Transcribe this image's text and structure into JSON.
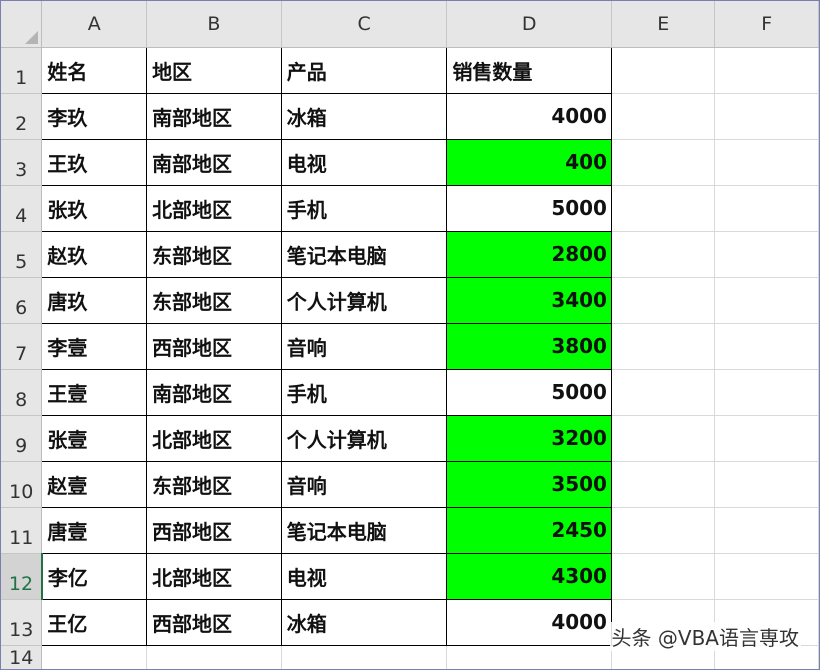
{
  "columns": [
    "A",
    "B",
    "C",
    "D",
    "E",
    "F"
  ],
  "header_row": {
    "row_num": "1",
    "name": "姓名",
    "region": "地区",
    "product": "产品",
    "qty": "销售数量"
  },
  "rows": [
    {
      "row_num": "2",
      "name": "李玖",
      "region": "南部地区",
      "product": "冰箱",
      "qty": "4000",
      "highlight": false
    },
    {
      "row_num": "3",
      "name": "王玖",
      "region": "南部地区",
      "product": "电视",
      "qty": "400",
      "highlight": true
    },
    {
      "row_num": "4",
      "name": "张玖",
      "region": "北部地区",
      "product": "手机",
      "qty": "5000",
      "highlight": false
    },
    {
      "row_num": "5",
      "name": "赵玖",
      "region": "东部地区",
      "product": "笔记本电脑",
      "qty": "2800",
      "highlight": true
    },
    {
      "row_num": "6",
      "name": "唐玖",
      "region": "东部地区",
      "product": "个人计算机",
      "qty": "3400",
      "highlight": true
    },
    {
      "row_num": "7",
      "name": "李壹",
      "region": "西部地区",
      "product": "音响",
      "qty": "3800",
      "highlight": true
    },
    {
      "row_num": "8",
      "name": "王壹",
      "region": "南部地区",
      "product": "手机",
      "qty": "5000",
      "highlight": false
    },
    {
      "row_num": "9",
      "name": "张壹",
      "region": "北部地区",
      "product": "个人计算机",
      "qty": "3200",
      "highlight": true
    },
    {
      "row_num": "10",
      "name": "赵壹",
      "region": "东部地区",
      "product": "音响",
      "qty": "3500",
      "highlight": true
    },
    {
      "row_num": "11",
      "name": "唐壹",
      "region": "西部地区",
      "product": "笔记本电脑",
      "qty": "2450",
      "highlight": true
    },
    {
      "row_num": "12",
      "name": "李亿",
      "region": "北部地区",
      "product": "电视",
      "qty": "4300",
      "highlight": true
    },
    {
      "row_num": "13",
      "name": "王亿",
      "region": "西部地区",
      "product": "冰箱",
      "qty": "4000",
      "highlight": false
    }
  ],
  "last_row_num": "14",
  "active_row": "12",
  "highlight_color": "#00ff00",
  "watermark": "头条 @VBA语言専攻"
}
